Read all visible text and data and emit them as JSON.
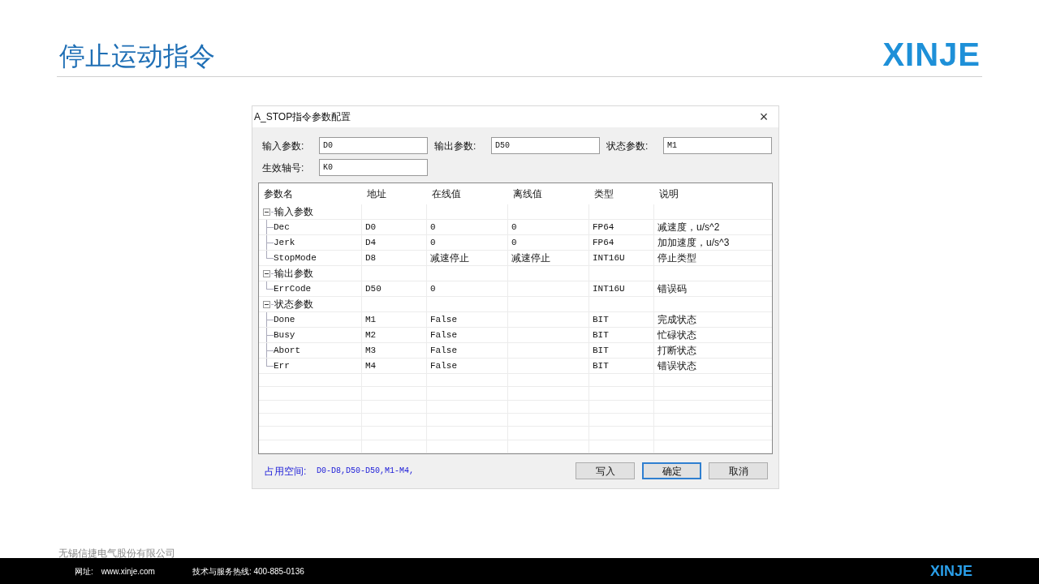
{
  "slide": {
    "title": "停止运动指令",
    "logo": "XINJE"
  },
  "dialog": {
    "title": "A_STOP指令参数配置",
    "close": "×",
    "fields": [
      {
        "label": "输入参数:",
        "value": "D0"
      },
      {
        "label": "输出参数:",
        "value": "D50"
      },
      {
        "label": "状态参数:",
        "value": "M1"
      },
      {
        "label": "生效轴号:",
        "value": "K0"
      }
    ],
    "table": {
      "columns": [
        "参数名",
        "地址",
        "在线值",
        "离线值",
        "类型",
        "说明"
      ],
      "groups": [
        {
          "name": "输入参数",
          "expanded": true,
          "children": [
            {
              "name": "Dec",
              "address": "D0",
              "online": "0",
              "offline": "0",
              "type": "FP64",
              "description": "减速度，u/s^2"
            },
            {
              "name": "Jerk",
              "address": "D4",
              "online": "0",
              "offline": "0",
              "type": "FP64",
              "description": "加加速度，u/s^3"
            },
            {
              "name": "StopMode",
              "address": "D8",
              "online": "减速停止",
              "offline": "减速停止",
              "type": "INT16U",
              "description": "停止类型"
            }
          ]
        },
        {
          "name": "输出参数",
          "expanded": true,
          "children": [
            {
              "name": "ErrCode",
              "address": "D50",
              "online": "0",
              "type": "INT16U",
              "description": "错误码"
            }
          ]
        },
        {
          "name": "状态参数",
          "expanded": true,
          "children": [
            {
              "name": "Done",
              "address": "M1",
              "online": "False",
              "type": "BIT",
              "description": "完成状态"
            },
            {
              "name": "Busy",
              "address": "M2",
              "online": "False",
              "type": "BIT",
              "description": "忙碌状态"
            },
            {
              "name": "Abort",
              "address": "M3",
              "online": "False",
              "type": "BIT",
              "description": "打断状态"
            },
            {
              "name": "Err",
              "address": "M4",
              "online": "False",
              "type": "BIT",
              "description": "错误状态"
            }
          ]
        }
      ]
    },
    "usage_label": "占用空间:",
    "usage_value": "D0-D8,D50-D50,M1-M4,",
    "buttons": [
      {
        "label": "写入",
        "default": false
      },
      {
        "label": "确定",
        "default": true
      },
      {
        "label": "取消",
        "default": false
      }
    ]
  },
  "footer": {
    "company": "无锡信捷电气股份有限公司",
    "website_label": "网址:",
    "website": "www.xinje.com",
    "hotline": "技术与服务热线: 400-885-0136",
    "logo": "XINJE"
  }
}
